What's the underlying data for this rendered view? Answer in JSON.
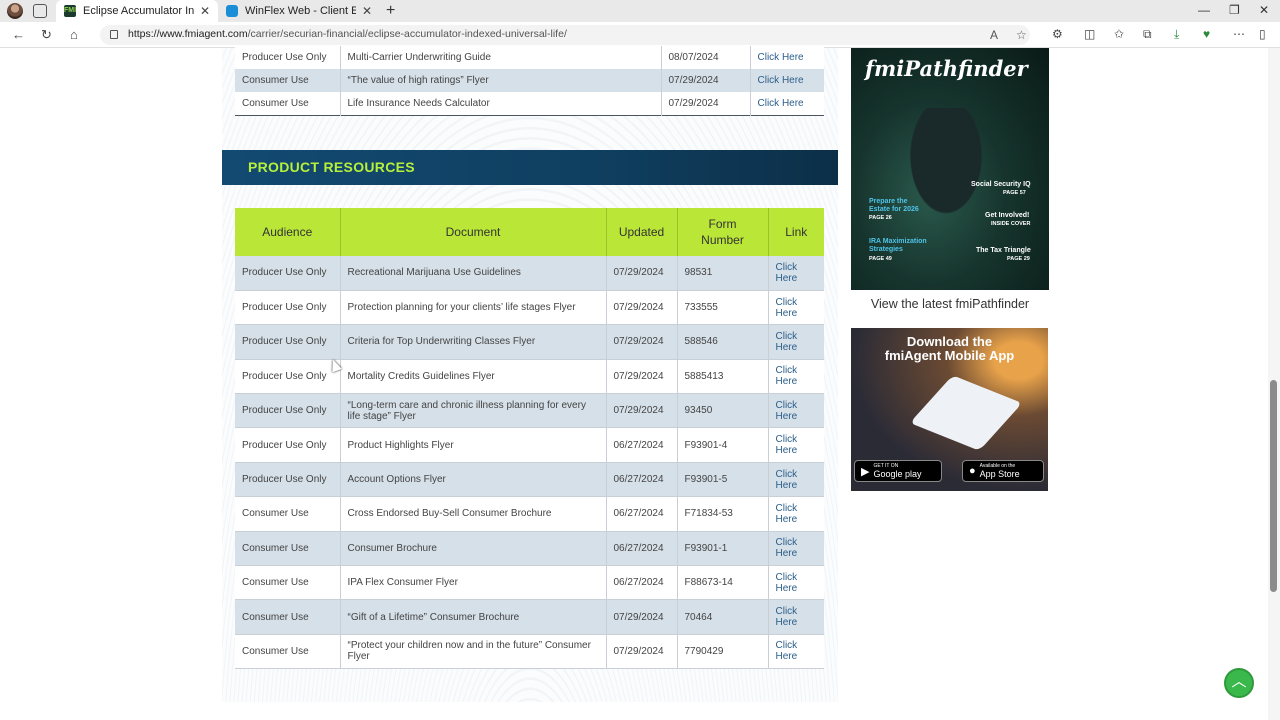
{
  "browser": {
    "tabs": [
      {
        "title": "Eclipse Accumulator Indexed Uni",
        "active": true,
        "icon": "fmi-favicon"
      },
      {
        "title": "WinFlex Web - Client Editor",
        "active": false,
        "icon": "winflex-favicon"
      }
    ],
    "url_domain": "https://www.fmiagent.com",
    "url_path": "/carrier/securian-financial/eclipse-accumulator-indexed-universal-life/"
  },
  "top_table": {
    "rows": [
      {
        "audience": "Producer Use Only",
        "document": "Multi-Carrier Underwriting Guide",
        "updated": "08/07/2024",
        "link": "Click Here"
      },
      {
        "audience": "Consumer Use",
        "document": "“The value of high ratings” Flyer",
        "updated": "07/29/2024",
        "link": "Click Here"
      },
      {
        "audience": "Consumer Use",
        "document": "Life Insurance Needs Calculator",
        "updated": "07/29/2024",
        "link": "Click Here"
      }
    ]
  },
  "product_resources": {
    "heading": "PRODUCT RESOURCES",
    "columns": {
      "audience": "Audience",
      "document": "Document",
      "updated": "Updated",
      "form_line1": "Form",
      "form_line2": "Number",
      "link": "Link"
    },
    "link_line1": "Click",
    "link_line2": "Here",
    "rows": [
      {
        "audience": "Producer Use Only",
        "document": "Recreational Marijuana Use Guidelines",
        "updated": "07/29/2024",
        "form": "98531"
      },
      {
        "audience": "Producer Use Only",
        "document": "Protection planning for your clients’ life stages Flyer",
        "updated": "07/29/2024",
        "form": "733555"
      },
      {
        "audience": "Producer Use Only",
        "document": "Criteria for Top Underwriting Classes Flyer",
        "updated": "07/29/2024",
        "form": "588546"
      },
      {
        "audience": "Producer Use Only",
        "document": "Mortality Credits Guidelines Flyer",
        "updated": "07/29/2024",
        "form": "5885413"
      },
      {
        "audience": "Producer Use Only",
        "document": "“Long-term care and chronic illness planning for every life stage” Flyer",
        "updated": "07/29/2024",
        "form": "93450"
      },
      {
        "audience": "Producer Use Only",
        "document": "Product Highlights Flyer",
        "updated": "06/27/2024",
        "form": "F93901-4"
      },
      {
        "audience": "Producer Use Only",
        "document": "Account Options Flyer",
        "updated": "06/27/2024",
        "form": "F93901-5"
      },
      {
        "audience": "Consumer Use",
        "document": "Cross Endorsed Buy-Sell Consumer Brochure",
        "updated": "06/27/2024",
        "form": "F71834-53"
      },
      {
        "audience": "Consumer Use",
        "document": "Consumer Brochure",
        "updated": "06/27/2024",
        "form": "F93901-1"
      },
      {
        "audience": "Consumer Use",
        "document": "IPA Flex Consumer Flyer",
        "updated": "06/27/2024",
        "form": "F88673-14"
      },
      {
        "audience": "Consumer Use",
        "document": "“Gift of a Lifetime” Consumer Brochure",
        "updated": "07/29/2024",
        "form": "70464"
      },
      {
        "audience": "Consumer Use",
        "document": "“Protect your children now and in the future” Consumer Flyer",
        "updated": "07/29/2024",
        "form": "7790429"
      }
    ]
  },
  "sidebar": {
    "magazine": {
      "title": "fmiPathfinder",
      "headlines": [
        {
          "text": "Social Security IQ",
          "page": "PAGE 57"
        },
        {
          "text": "Prepare the Estate for 2026",
          "page": "PAGE 26"
        },
        {
          "text": "Get Involved!",
          "page": "INSIDE COVER"
        },
        {
          "text": "IRA Maximization Strategies",
          "page": "PAGE 49"
        },
        {
          "text": "The Tax Triangle",
          "page": "PAGE 29"
        }
      ]
    },
    "magazine_caption": "View the latest fmiPathfinder",
    "app_ad": {
      "line1": "Download the",
      "line2": "fmiAgent Mobile App",
      "google_small": "GET IT ON",
      "google_label": "Google play",
      "apple_small": "Available on the",
      "apple_label": "App Store"
    }
  },
  "colors": {
    "accent_green": "#b9e637",
    "banner_blue": "#134a72",
    "row_alt": "#d6e0e8",
    "link": "#2b5e8a"
  }
}
